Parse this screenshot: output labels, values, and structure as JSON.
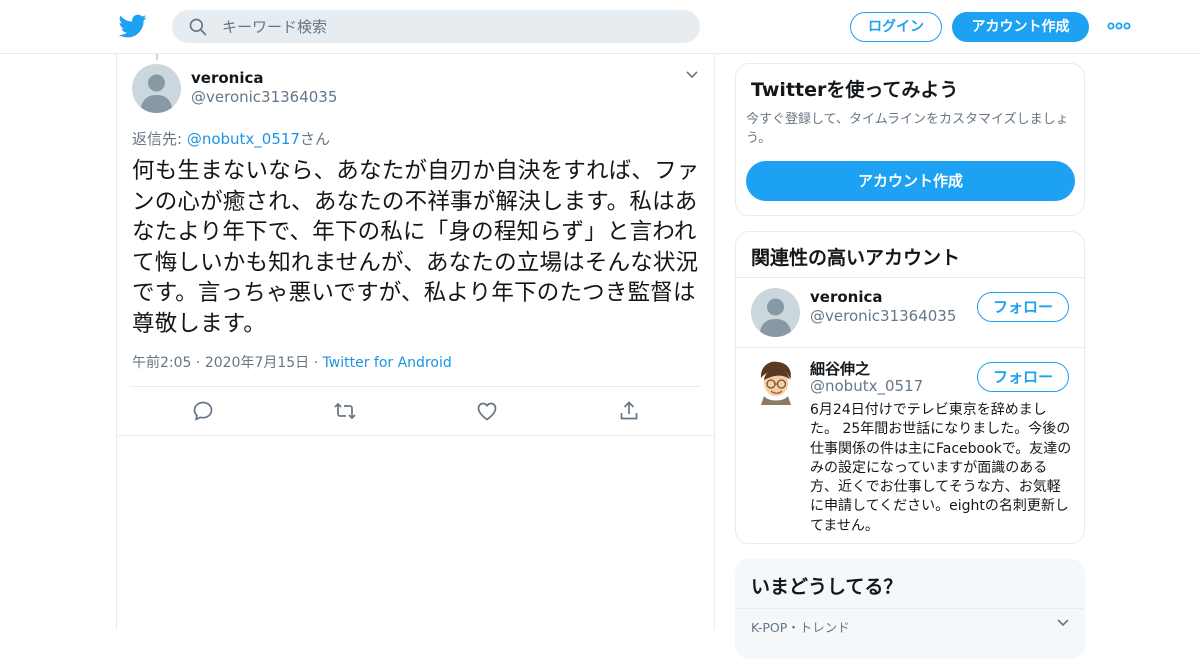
{
  "header": {
    "search_placeholder": "キーワード検索",
    "login_label": "ログイン",
    "signup_label": "アカウント作成"
  },
  "tweet": {
    "author_name": "veronica",
    "author_handle": "@veronic31364035",
    "replying_prefix": "返信先: ",
    "replying_mention": "@nobutx_0517",
    "replying_suffix": "さん",
    "text": "何も生まないなら、あなたが自刃か自決をすれば、ファンの心が癒され、あなたの不祥事が解決します。私はあなたより年下で、年下の私に「身の程知らず」と言われて悔しいかも知れませんが、あなたの立場はそんな状況です。言っちゃ悪いですが、私より年下のたつき監督は尊敬します。",
    "time": "午前2:05",
    "date": "2020年7月15日",
    "source": "Twitter for Android",
    "actions": [
      "reply-icon",
      "retweet-icon",
      "like-icon",
      "share-icon"
    ]
  },
  "signup_card": {
    "title": "Twitterを使ってみよう",
    "description": "今すぐ登録して、タイムラインをカスタマイズしましょう。",
    "button_label": "アカウント作成"
  },
  "related_accounts": {
    "title": "関連性の高いアカウント",
    "accounts": [
      {
        "name": "veronica",
        "handle": "@veronic31364035",
        "follow_label": "フォロー",
        "bio": ""
      },
      {
        "name": "細谷伸之",
        "handle": "@nobutx_0517",
        "follow_label": "フォロー",
        "bio": "6月24日付けでテレビ東京を辞めました。 25年間お世話になりました。今後の仕事関係の件は主にFacebookで。友達のみの設定になっていますが面識のある方、近くでお仕事してそうな方、お気軽に申請してください。eightの名刺更新してません。"
      }
    ]
  },
  "trends": {
    "title": "いまどうしてる？",
    "first_trend_context": "K-POP・トレンド"
  },
  "colors": {
    "accent": "#1da1f2",
    "link": "#1b95e0",
    "secondary_text": "#657786",
    "border": "#e6ecf0"
  }
}
